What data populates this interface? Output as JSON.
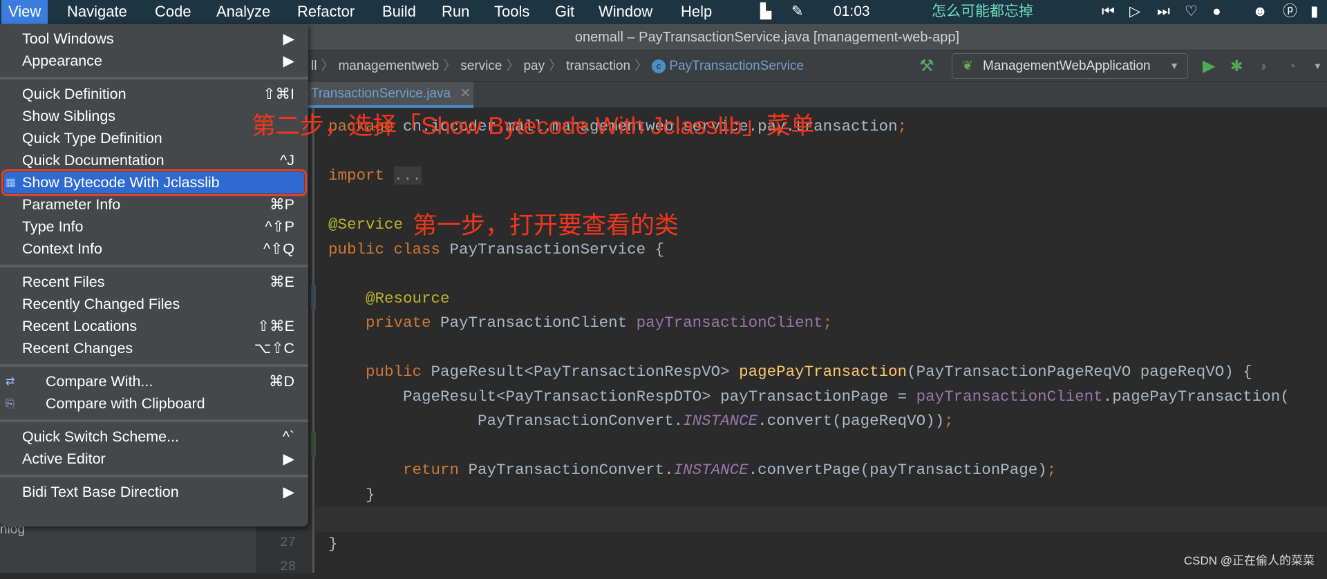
{
  "menubar": {
    "items": [
      "View",
      "Navigate",
      "Code",
      "Analyze",
      "Refactor",
      "Build",
      "Run",
      "Tools",
      "Git",
      "Window",
      "Help"
    ],
    "clock": "01:03",
    "song": "怎么可能都忘掉"
  },
  "window": {
    "title": "onemall – PayTransactionService.java [management-web-app]"
  },
  "breadcrumb": [
    "ll",
    "managementweb",
    "service",
    "pay",
    "transaction",
    "PayTransactionService"
  ],
  "run_config": "ManagementWebApplication",
  "tab": {
    "label": "TransactionService.java"
  },
  "menu": {
    "items": [
      {
        "label": "Tool Windows",
        "shortcut": "▶"
      },
      {
        "label": "Appearance",
        "shortcut": "▶"
      },
      {
        "sep": true
      },
      {
        "label": "Quick Definition",
        "shortcut": "⇧⌘I"
      },
      {
        "label": "Show Siblings",
        "shortcut": ""
      },
      {
        "label": "Quick Type Definition",
        "shortcut": ""
      },
      {
        "label": "Quick Documentation",
        "shortcut": "^J"
      },
      {
        "label": "Show Bytecode With Jclasslib",
        "shortcut": "",
        "highlighted": true
      },
      {
        "label": "Parameter Info",
        "shortcut": "⌘P"
      },
      {
        "label": "Type Info",
        "shortcut": "^⇧P"
      },
      {
        "label": "Context Info",
        "shortcut": "^⇧Q"
      },
      {
        "sep": true
      },
      {
        "label": "Recent Files",
        "shortcut": "⌘E"
      },
      {
        "label": "Recently Changed Files",
        "shortcut": ""
      },
      {
        "label": "Recent Locations",
        "shortcut": "⇧⌘E"
      },
      {
        "label": "Recent Changes",
        "shortcut": "⌥⇧C"
      },
      {
        "sep": true
      },
      {
        "label": "Compare With...",
        "shortcut": "⌘D",
        "icon": "compare-icon"
      },
      {
        "label": "Compare with Clipboard",
        "shortcut": "",
        "icon": "clipboard-compare-icon"
      },
      {
        "sep": true
      },
      {
        "label": "Quick Switch Scheme...",
        "shortcut": "^`"
      },
      {
        "label": "Active Editor",
        "shortcut": "▶"
      },
      {
        "sep": true
      },
      {
        "label": "Bidi Text Base Direction",
        "shortcut": "▶"
      }
    ]
  },
  "annotations": {
    "step2": "第二步，选择「Show Bytecode With Jclasslib」菜单",
    "step1": "第一步，打开要查看的类"
  },
  "left_panel": {
    "item": "nlog"
  },
  "line_numbers": [
    "27",
    "28"
  ],
  "code": [
    [
      [
        "package",
        "kw"
      ],
      [
        " cn.iocoder.mall.managementweb.service.pay.transaction",
        ""
      ],
      [
        ";",
        "kw"
      ]
    ],
    [],
    [
      [
        "import",
        "kw"
      ],
      [
        " ",
        ""
      ],
      [
        "...",
        "fold"
      ]
    ],
    [],
    [
      [
        "@Service",
        "ann"
      ]
    ],
    [
      [
        "public class",
        "kw"
      ],
      [
        " PayTransactionService {",
        ""
      ]
    ],
    [],
    [
      [
        "    ",
        ""
      ],
      [
        "@Resource",
        "ann"
      ]
    ],
    [
      [
        "    ",
        ""
      ],
      [
        "private",
        "kw"
      ],
      [
        " PayTransactionClient ",
        ""
      ],
      [
        "payTransactionClient",
        "fld"
      ],
      [
        ";",
        "kw"
      ]
    ],
    [],
    [
      [
        "    ",
        ""
      ],
      [
        "public",
        "kw"
      ],
      [
        " PageResult<PayTransactionRespVO> ",
        ""
      ],
      [
        "pagePayTransaction",
        "mth"
      ],
      [
        "(PayTransactionPageReqVO pageReqVO) {",
        ""
      ]
    ],
    [
      [
        "        PageResult<PayTransactionRespDTO> payTransactionPage = ",
        ""
      ],
      [
        "payTransactionClient",
        "fld"
      ],
      [
        ".pagePayTransaction(",
        ""
      ]
    ],
    [
      [
        "                PayTransactionConvert.",
        ""
      ],
      [
        "INSTANCE",
        "it"
      ],
      [
        ".convert(pageReqVO))",
        ""
      ],
      [
        ";",
        "kw"
      ]
    ],
    [],
    [
      [
        "        ",
        ""
      ],
      [
        "return",
        "kw"
      ],
      [
        " PayTransactionConvert.",
        ""
      ],
      [
        "INSTANCE",
        "it"
      ],
      [
        ".convertPage(payTransactionPage)",
        ""
      ],
      [
        ";",
        "kw"
      ]
    ],
    [
      [
        "    }",
        ""
      ]
    ],
    [],
    [
      [
        "}",
        ""
      ]
    ]
  ],
  "watermark": "CSDN @正在偷人的菜菜",
  "colors": {
    "accent": "#3b7ddd",
    "annotation_red": "#f0361c",
    "keyword": "#cc7832",
    "field": "#9876aa",
    "method": "#ffc66d"
  }
}
